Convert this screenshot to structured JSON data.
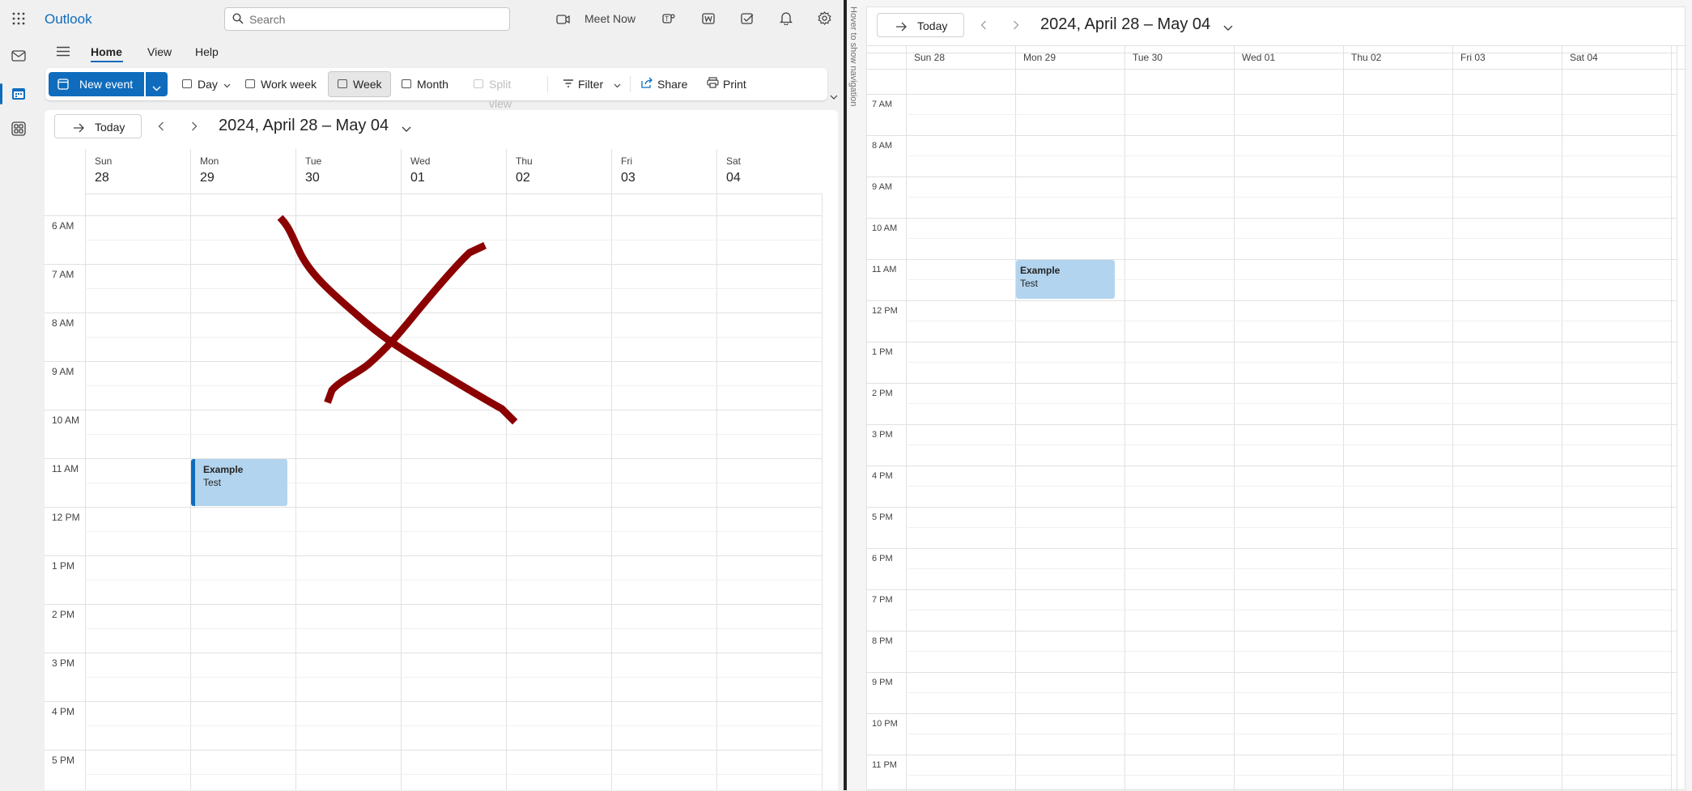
{
  "app": {
    "title": "Outlook",
    "brand_color": "#0f6cbd"
  },
  "search": {
    "placeholder": "Search"
  },
  "topbar": {
    "meet_now": "Meet Now"
  },
  "tabs": [
    {
      "label": "Home"
    },
    {
      "label": "View"
    },
    {
      "label": "Help"
    }
  ],
  "ribbon": {
    "new_event": "New event",
    "day": "Day",
    "work_week": "Work week",
    "week": "Week",
    "month": "Month",
    "split_view": "Split view",
    "filter": "Filter",
    "share": "Share",
    "print": "Print"
  },
  "calendar": {
    "today": "Today",
    "range": "2024, April 28 – May 04",
    "days": [
      {
        "name": "Sun",
        "date": "28"
      },
      {
        "name": "Mon",
        "date": "29"
      },
      {
        "name": "Tue",
        "date": "30"
      },
      {
        "name": "Wed",
        "date": "01"
      },
      {
        "name": "Thu",
        "date": "02"
      },
      {
        "name": "Fri",
        "date": "03"
      },
      {
        "name": "Sat",
        "date": "04"
      }
    ],
    "hours": [
      "6 AM",
      "7 AM",
      "8 AM",
      "9 AM",
      "10 AM",
      "11 AM",
      "12 PM",
      "1 PM",
      "2 PM",
      "3 PM",
      "4 PM",
      "5 PM"
    ],
    "event": {
      "title": "Example",
      "subtitle": "Test"
    }
  },
  "right": {
    "nav_hint": "Hover to show navigation",
    "today": "Today",
    "range": "2024, April 28 – May 04",
    "days": [
      "Sun 28",
      "Mon 29",
      "Tue 30",
      "Wed 01",
      "Thu 02",
      "Fri 03",
      "Sat 04"
    ],
    "hours": [
      "7 AM",
      "8 AM",
      "9 AM",
      "10 AM",
      "11 AM",
      "12 PM",
      "1 PM",
      "2 PM",
      "3 PM",
      "4 PM",
      "5 PM",
      "6 PM",
      "7 PM",
      "8 PM",
      "9 PM",
      "10 PM",
      "11 PM"
    ],
    "event": {
      "title": "Example",
      "subtitle": "Test"
    }
  },
  "annotation": {
    "color": "#8b0000"
  }
}
